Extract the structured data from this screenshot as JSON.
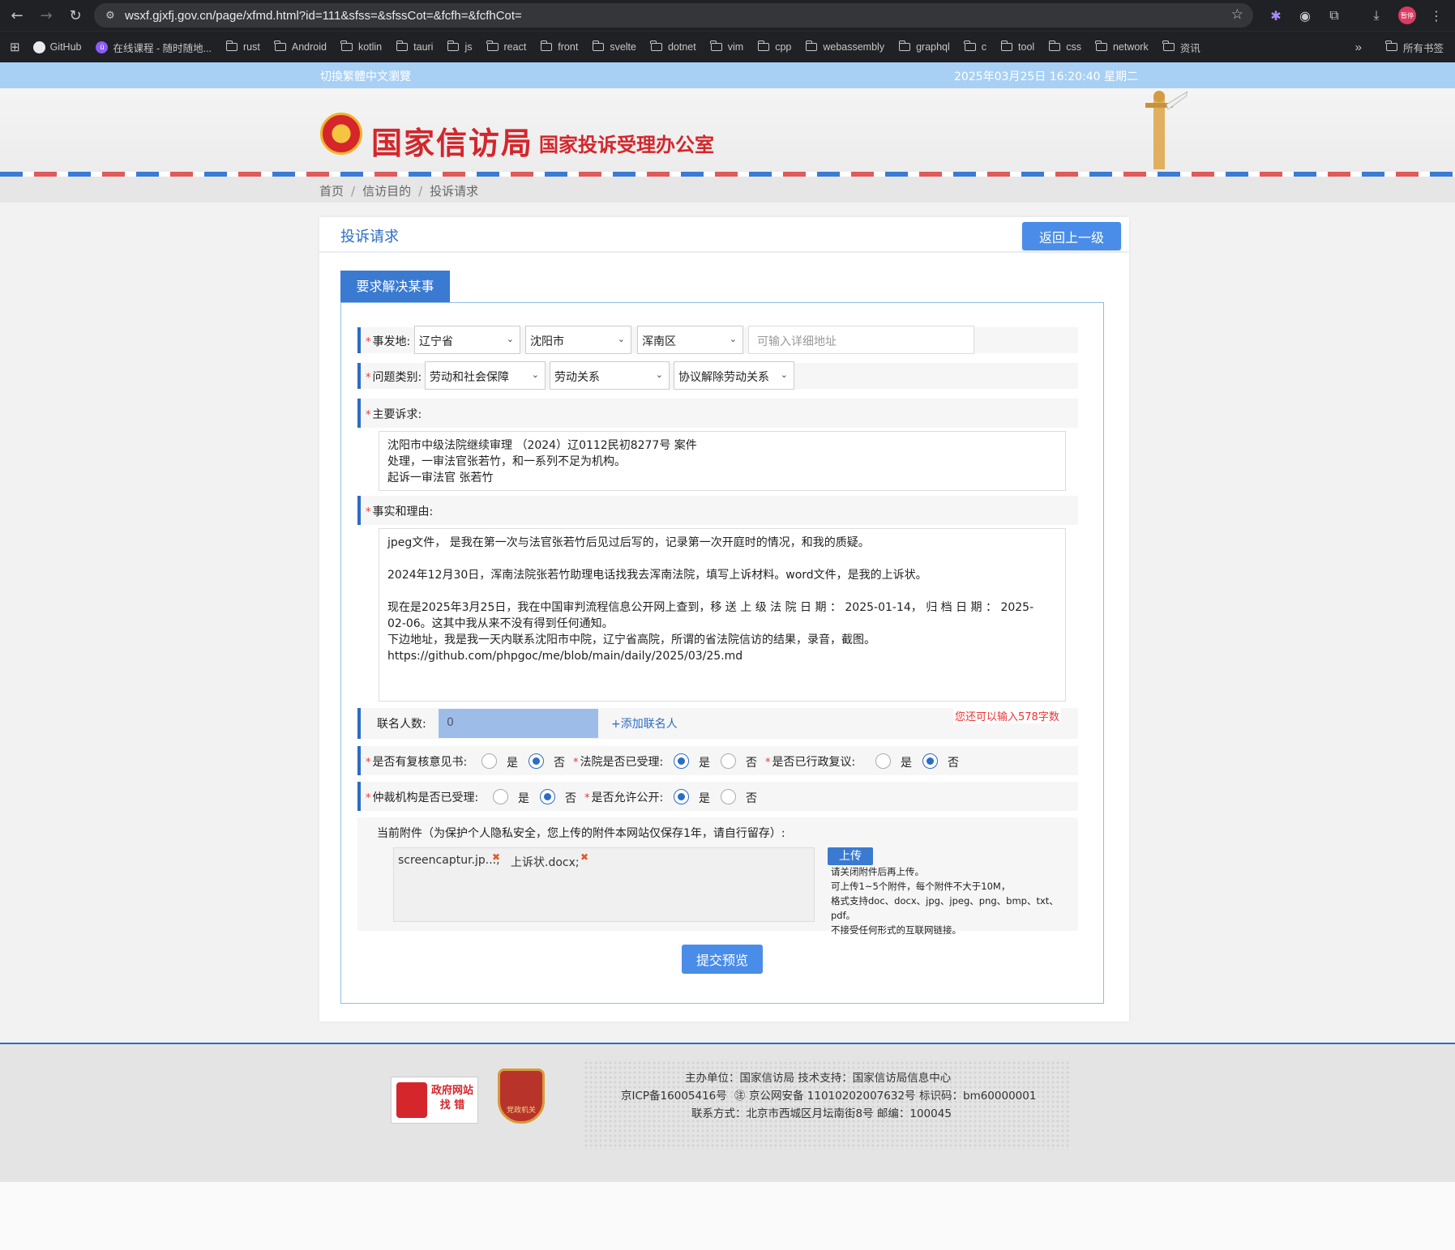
{
  "browser": {
    "url": "wsxf.gjxfj.gov.cn/page/xfmd.html?id=111&sfss=&sfssCot=&fcfh=&fcfhCot=",
    "profile_label": "暂停",
    "bookmarks": [
      "GitHub",
      "在线课程 - 随时随地...",
      "rust",
      "Android",
      "kotlin",
      "tauri",
      "js",
      "react",
      "front",
      "svelte",
      "dotnet",
      "vim",
      "cpp",
      "webassembly",
      "graphql",
      "c",
      "tool",
      "css",
      "network",
      "资讯"
    ],
    "all_bookmarks": "所有书签",
    "more": "»"
  },
  "topbar": {
    "traditional_link": "切換繁體中文瀏覽",
    "datetime": "2025年03月25日  16:20:40  星期二"
  },
  "banner": {
    "title_main": "国家信访局",
    "title_sub": "国家投诉受理办公室"
  },
  "breadcrumb": [
    "首页",
    "信访目的",
    "投诉请求"
  ],
  "panel": {
    "title": "投诉请求",
    "back_label": "返回上一级",
    "tab_label": "要求解决某事"
  },
  "form": {
    "location_label": "事发地:",
    "province": "辽宁省",
    "city": "沈阳市",
    "district": "浑南区",
    "address_placeholder": "可输入详细地址",
    "category_label": "问题类别:",
    "category1": "劳动和社会保障",
    "category2": "劳动关系",
    "category3": "协议解除劳动关系",
    "main_appeal_label": "主要诉求:",
    "main_appeal": "沈阳市中级法院继续审理 （2024）辽0112民初8277号 案件\n处理，一审法官张若竹，和一系列不足为机构。\n起诉一审法官 张若竹",
    "facts_label": "事实和理由:",
    "facts": "jpeg文件， 是我在第一次与法官张若竹后见过后写的，记录第一次开庭时的情况，和我的质疑。\n\n2024年12月30日，浑南法院张若竹助理电话找我去浑南法院，填写上诉材料。word文件，是我的上诉状。\n\n现在是2025年3月25日，我在中国审判流程信息公开网上查到，移 送 上 级 法 院 日 期 ： 2025-01-14， 归 档 日 期 ： 2025-\n02-06。这其中我从来不没有得到任何通知。\n下边地址，我是我一天内联系沈阳市中院，辽宁省高院，所谓的省法院信访的结果，录音，截图。\nhttps://github.com/phpgoc/me/blob/main/daily/2025/03/25.md",
    "cosign_label": "联名人数:",
    "cosign_count": "0",
    "add_cosigner": "+添加联名人",
    "remaining": "您还可以输入578字数",
    "review_q": "是否有复核意见书:",
    "court_q": "法院是否已受理:",
    "admin_q": "是否已行政复议:",
    "arb_q": "仲裁机构是否已受理:",
    "public_q": "是否允许公开:",
    "yes": "是",
    "no": "否",
    "attach_label": "当前附件（为保护个人隐私安全，您上传的附件本网站仅保存1年，请自行留存）:",
    "files": [
      "screencaptur.jp...;",
      "上诉状.docx;"
    ],
    "upload_label": "上传",
    "upload_hints": [
      "请关闭附件后再上传。",
      "可上传1~5个附件，每个附件不大于10M，",
      "格式支持doc、docx、jpg、jpeg、png、bmp、txt、pdf。",
      "不接受任何形式的互联网链接。"
    ],
    "submit_label": "提交预览"
  },
  "footer": {
    "line1": "主办单位：国家信访局    技术支持：国家信访局信息中心",
    "line2_icp": "京ICP备16005416号",
    "line2_police": "京公网安备 11010202007632号",
    "line2_code": "标识码：bm60000001",
    "line3": "联系方式：北京市西城区月坛南街8号    邮编：100045",
    "badge1_line1": "政府网站",
    "badge1_line2": "找 错",
    "badge2": "党政机关"
  }
}
